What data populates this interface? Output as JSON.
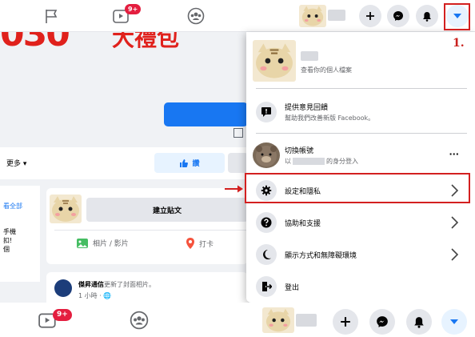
{
  "nav": {
    "video_badge": "9+"
  },
  "background": {
    "banner_text": "030",
    "banner_sub": "大禮包",
    "more_label": "更多 ▾",
    "like_label": "讚",
    "left_col": [
      "看全部",
      "手機",
      "扣!",
      "個"
    ],
    "composer": {
      "create_post": "建立貼文",
      "photo_label": "相片 / 影片",
      "checkin_label": "打卡"
    },
    "post": {
      "author": "傑昇通信",
      "action": "更新了封面相片。",
      "time": "1 小時 · 🌐"
    }
  },
  "menu": {
    "profile_sub": "查看你的個人檔案",
    "feedback_title": "提供意見回饋",
    "feedback_sub": "幫助我們改善新版 Facebook。",
    "switch_title": "切換帳號",
    "switch_sub_prefix": "以",
    "switch_sub_suffix": "的身分登入",
    "more_dots": "···",
    "settings": "設定和隱私",
    "help": "協助和支援",
    "display": "顯示方式和無障礙環境",
    "logout": "登出"
  },
  "annotation": {
    "step_label": "1.",
    "accent_color": "#d32020"
  },
  "bottom_nav": {
    "video_badge": "9+"
  },
  "colors": {
    "facebook_blue": "#1877f2",
    "badge_red": "#e41e3f"
  }
}
